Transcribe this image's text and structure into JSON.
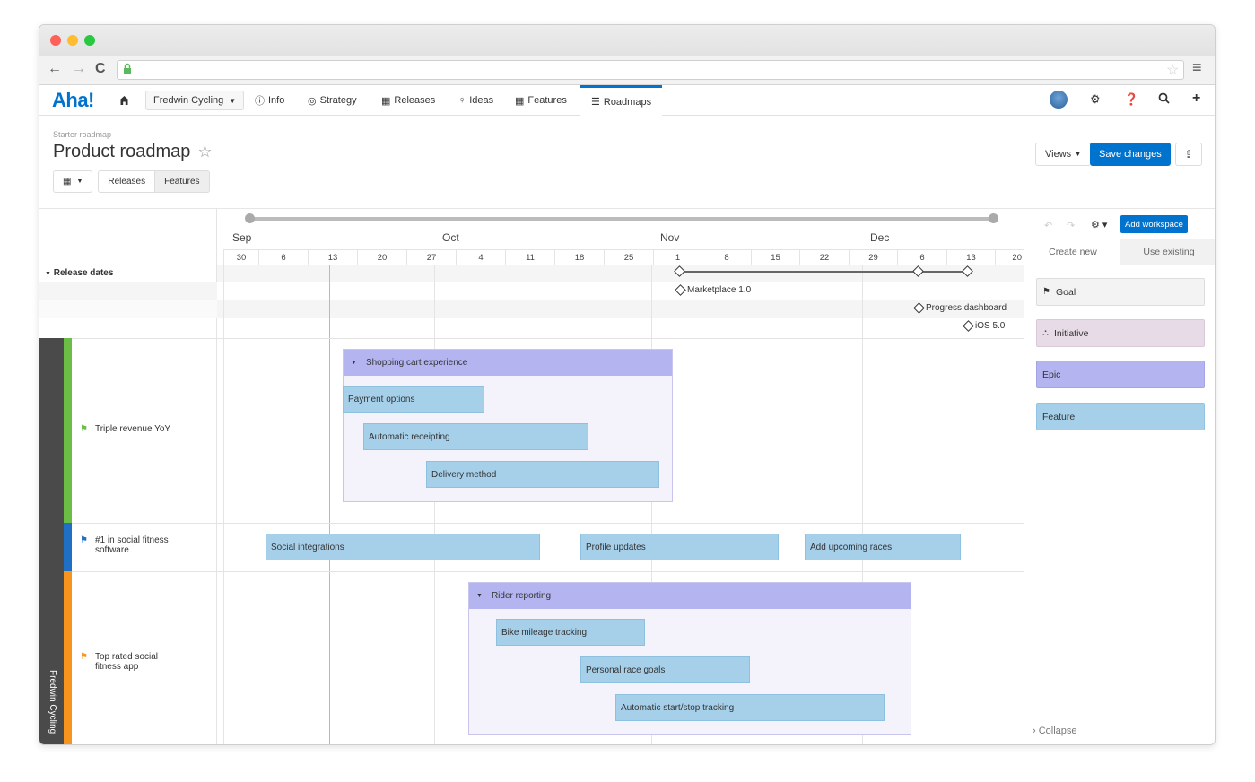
{
  "browser": {
    "traffic_colors": [
      "#fe5f57",
      "#febc2e",
      "#28c840"
    ],
    "nav_back": "←",
    "nav_forward": "→",
    "nav_reload": "C",
    "star_glyph": "☆",
    "menu_glyph": "≡"
  },
  "app": {
    "logo": "Aha!",
    "nav": {
      "workspace": "Fredwin Cycling",
      "items": [
        "Info",
        "Strategy",
        "Releases",
        "Ideas",
        "Features",
        "Roadmaps"
      ],
      "active": "Roadmaps"
    },
    "accent": "#0073cf"
  },
  "page": {
    "breadcrumb": "Starter roadmap",
    "title": "Product roadmap",
    "view_tabs": [
      "Releases",
      "Features"
    ],
    "active_view_tab": "Features",
    "views_label": "Views",
    "save_label": "Save changes"
  },
  "timeline": {
    "months": [
      "Sep",
      "Oct",
      "Nov",
      "Dec"
    ],
    "days": [
      "30",
      "6",
      "13",
      "20",
      "27",
      "4",
      "11",
      "18",
      "25",
      "1",
      "8",
      "15",
      "22",
      "29",
      "6",
      "13",
      "20"
    ],
    "release_section": "Release dates",
    "milestones": [
      "Marketplace 1.0",
      "Progress dashboard",
      "iOS 5.0"
    ]
  },
  "workspace_strip": "Fredwin Cycling",
  "goals": [
    {
      "label": "Triple revenue YoY",
      "color": "#6cbd45"
    },
    {
      "label": "#1 in social fitness software",
      "color": "#1f6fc4"
    },
    {
      "label": "Top rated social fitness app",
      "color": "#f7941d"
    }
  ],
  "epics": [
    {
      "title": "Shopping cart experience",
      "features": [
        "Payment options",
        "Automatic receipting",
        "Delivery method"
      ]
    },
    {
      "title": "Rider reporting",
      "features": [
        "Bike mileage tracking",
        "Personal race goals",
        "Automatic start/stop tracking"
      ]
    }
  ],
  "loose_features": [
    "Social integrations",
    "Profile updates",
    "Add upcoming races"
  ],
  "panel": {
    "add_workspace": "Add workspace",
    "tabs": [
      "Create new",
      "Use existing"
    ],
    "cards": [
      {
        "label": "Goal",
        "color": "#f3f3f3"
      },
      {
        "label": "Initiative",
        "color": "#e7dbe7"
      },
      {
        "label": "Epic",
        "color": "#b4b4f1"
      },
      {
        "label": "Feature",
        "color": "#a6d0ea"
      }
    ],
    "collapse": "Collapse"
  }
}
